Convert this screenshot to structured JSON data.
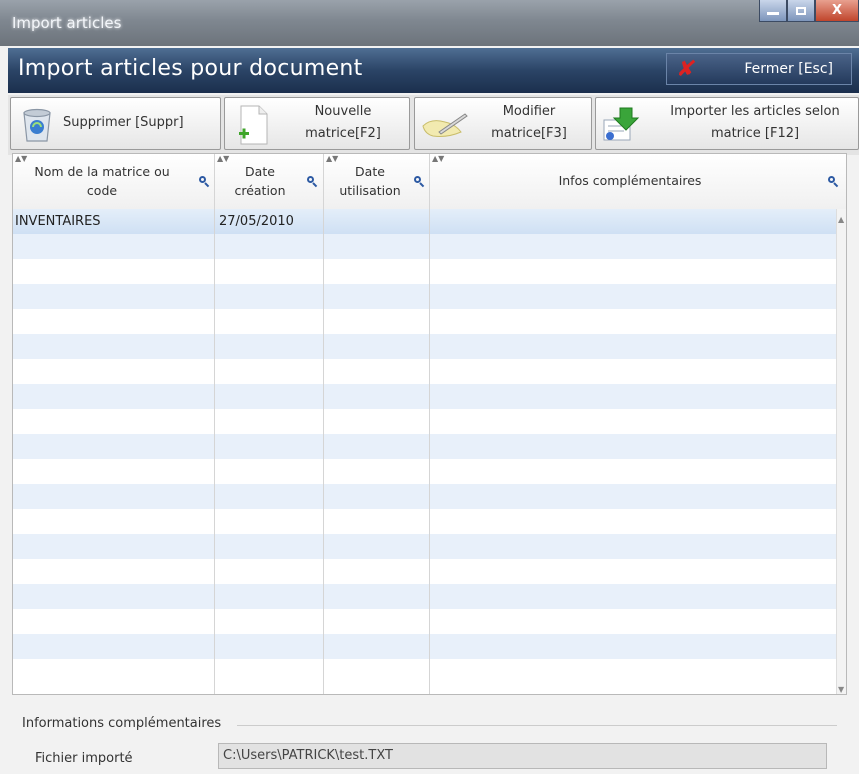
{
  "window": {
    "title": "Import articles"
  },
  "header": {
    "title": "Import articles pour document",
    "close_label": "Fermer [Esc]"
  },
  "toolbar": {
    "delete_label": "Supprimer [Suppr]",
    "new_label_1": "Nouvelle",
    "new_label_2": "matrice[F2]",
    "edit_label_1": "Modifier",
    "edit_label_2": "matrice[F3]",
    "import_label_1": "Importer les articles selon",
    "import_label_2": "matrice [F12]"
  },
  "grid": {
    "columns": [
      {
        "line1": "Nom de la matrice ou",
        "line2": "code"
      },
      {
        "line1": "Date",
        "line2": "création"
      },
      {
        "line1": "Date",
        "line2": "utilisation"
      },
      {
        "line1": "Infos complémentaires",
        "line2": ""
      }
    ],
    "rows": [
      {
        "name": "INVENTAIRES",
        "created": "27/05/2010",
        "used": "",
        "infos": ""
      }
    ]
  },
  "footer": {
    "group_label": "Informations complémentaires",
    "file_label": "Fichier importé",
    "file_value": "C:\\Users\\PATRICK\\test.TXT"
  },
  "colors": {
    "header_bg": "#2b4466",
    "row_alt": "#e8f0fa",
    "selected_row": "#cfe0f4",
    "close_x": "#dd2222"
  }
}
